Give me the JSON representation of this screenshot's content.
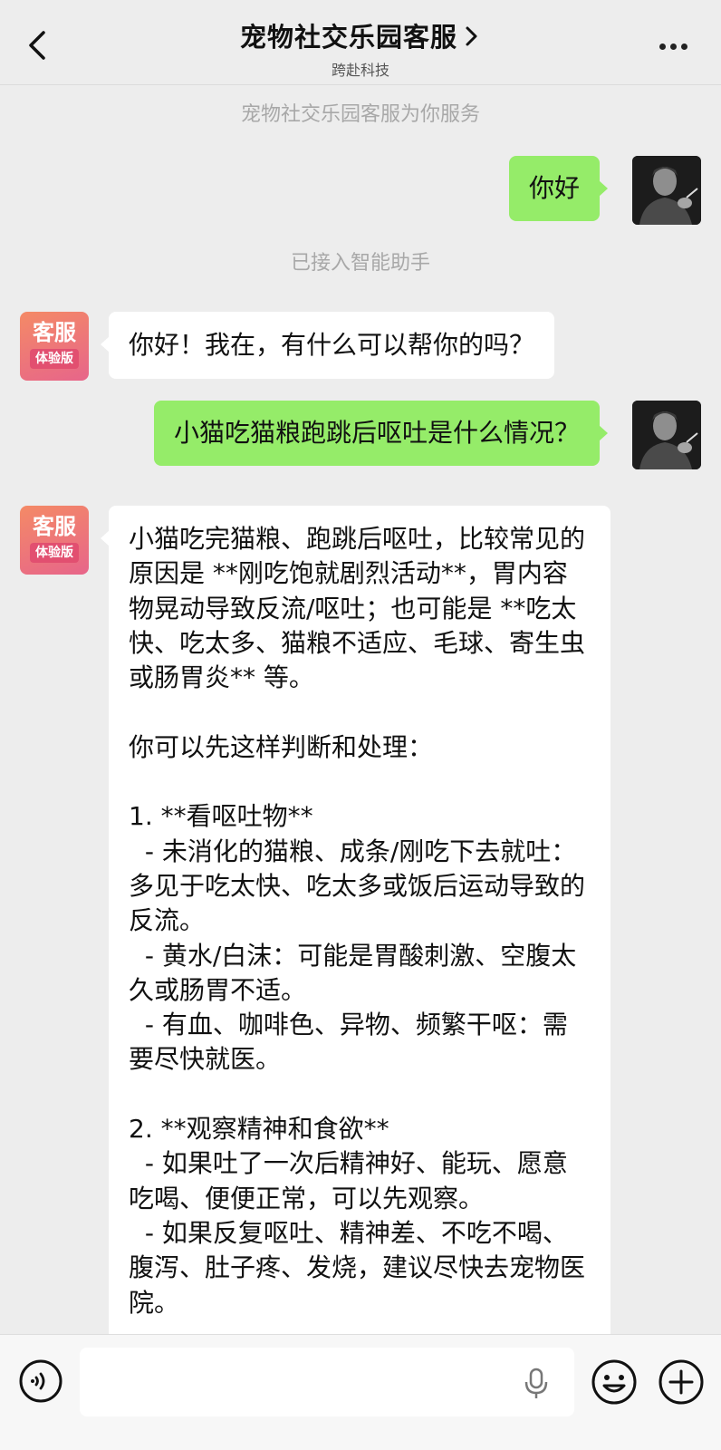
{
  "header": {
    "title": "宠物社交乐园客服",
    "subtitle": "跨赴科技"
  },
  "chat": {
    "system_top": "宠物社交乐园客服为你服务",
    "system_mid": "已接入智能助手",
    "bot_avatar": {
      "line1": "客服",
      "line2": "体验版"
    },
    "messages": [
      {
        "from": "me",
        "text": "你好"
      },
      {
        "from": "bot",
        "text": "你好！我在，有什么可以帮你的吗？"
      },
      {
        "from": "me",
        "text": "小猫吃猫粮跑跳后呕吐是什么情况？"
      },
      {
        "from": "bot",
        "text": "小猫吃完猫粮、跑跳后呕吐，比较常见的原因是 **刚吃饱就剧烈活动**，胃内容物晃动导致反流/呕吐；也可能是 **吃太快、吃太多、猫粮不适应、毛球、寄生虫或肠胃炎** 等。\n\n你可以先这样判断和处理：\n\n1. **看呕吐物**\n  - 未消化的猫粮、成条/刚吃下去就吐：多见于吃太快、吃太多或饭后运动导致的反流。\n  - 黄水/白沫：可能是胃酸刺激、空腹太久或肠胃不适。\n  - 有血、咖啡色、异物、频繁干呕：需要尽快就医。\n\n2. **观察精神和食欲**\n  - 如果吐了一次后精神好、能玩、愿意吃喝、便便正常，可以先观察。\n  - 如果反复呕吐、精神差、不吃不喝、腹泻、肚子疼、发烧，建议尽快去宠物医院。"
      }
    ]
  },
  "input": {
    "placeholder": ""
  },
  "icons": {
    "back": "chevron-left-icon",
    "title_chevron": "chevron-right-icon",
    "more": "more-dots-icon",
    "voice": "voice-icon",
    "mic": "microphone-icon",
    "emoji": "emoji-icon",
    "plus": "plus-icon"
  },
  "colors": {
    "background": "#ededed",
    "my_bubble": "#95ec69",
    "bot_bubble": "#ffffff",
    "bot_avatar_gradient_start": "#f48a66",
    "bot_avatar_gradient_end": "#e7658a"
  }
}
